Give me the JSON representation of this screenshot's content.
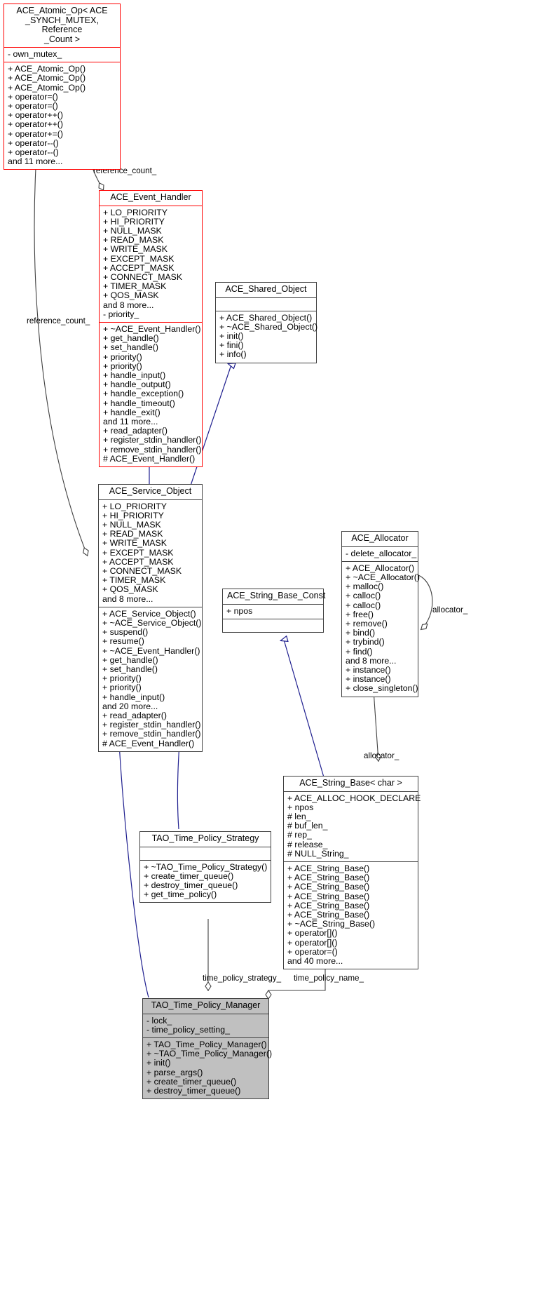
{
  "diagram": {
    "kind": "uml-class-collaboration-diagram",
    "colors": {
      "highlight_border": "#ff0000",
      "plain_border": "#404040",
      "focus_fill": "#c0c0c0",
      "inheritance_edge": "#1f1f8f",
      "aggregation_edge": "#404040",
      "background": "#ffffff"
    }
  },
  "nodes": {
    "ace_atomic_op": {
      "title": "ACE_Atomic_Op< ACE\n_SYNCH_MUTEX, Reference\n_Count >",
      "attributes": [
        "- own_mutex_"
      ],
      "operations": [
        "+ ACE_Atomic_Op()",
        "+ ACE_Atomic_Op()",
        "+ ACE_Atomic_Op()",
        "+ operator=()",
        "+ operator=()",
        "+ operator++()",
        "+ operator++()",
        "+ operator+=()",
        "+ operator--()",
        "+ operator--()",
        "and 11 more..."
      ]
    },
    "ace_event_handler": {
      "title": "ACE_Event_Handler",
      "attributes": [
        "+ LO_PRIORITY",
        "+ HI_PRIORITY",
        "+ NULL_MASK",
        "+ READ_MASK",
        "+ WRITE_MASK",
        "+ EXCEPT_MASK",
        "+ ACCEPT_MASK",
        "+ CONNECT_MASK",
        "+ TIMER_MASK",
        "+ QOS_MASK",
        "and 8 more...",
        "- priority_"
      ],
      "operations": [
        "+ ~ACE_Event_Handler()",
        "+ get_handle()",
        "+ set_handle()",
        "+ priority()",
        "+ priority()",
        "+ handle_input()",
        "+ handle_output()",
        "+ handle_exception()",
        "+ handle_timeout()",
        "+ handle_exit()",
        "and 11 more...",
        "+ read_adapter()",
        "+ register_stdin_handler()",
        "+ remove_stdin_handler()",
        "# ACE_Event_Handler()"
      ]
    },
    "ace_shared_object": {
      "title": "ACE_Shared_Object",
      "attributes": [],
      "operations": [
        "+ ACE_Shared_Object()",
        "+ ~ACE_Shared_Object()",
        "+ init()",
        "+ fini()",
        "+ info()"
      ]
    },
    "ace_service_object": {
      "title": "ACE_Service_Object",
      "attributes": [
        "+ LO_PRIORITY",
        "+ HI_PRIORITY",
        "+ NULL_MASK",
        "+ READ_MASK",
        "+ WRITE_MASK",
        "+ EXCEPT_MASK",
        "+ ACCEPT_MASK",
        "+ CONNECT_MASK",
        "+ TIMER_MASK",
        "+ QOS_MASK",
        "and 8 more..."
      ],
      "operations": [
        "+ ACE_Service_Object()",
        "+ ~ACE_Service_Object()",
        "+ suspend()",
        "+ resume()",
        "+ ~ACE_Event_Handler()",
        "+ get_handle()",
        "+ set_handle()",
        "+ priority()",
        "+ priority()",
        "+ handle_input()",
        "and 20 more...",
        "+ read_adapter()",
        "+ register_stdin_handler()",
        "+ remove_stdin_handler()",
        "# ACE_Event_Handler()"
      ]
    },
    "ace_allocator": {
      "title": "ACE_Allocator",
      "attributes": [
        "- delete_allocator_"
      ],
      "operations": [
        "+ ACE_Allocator()",
        "+ ~ACE_Allocator()",
        "+ malloc()",
        "+ calloc()",
        "+ calloc()",
        "+ free()",
        "+ remove()",
        "+ bind()",
        "+ trybind()",
        "+ find()",
        "and 8 more...",
        "+ instance()",
        "+ instance()",
        "+ close_singleton()"
      ]
    },
    "ace_string_base_const": {
      "title": "ACE_String_Base_Const",
      "attributes": [
        "+ npos"
      ],
      "operations": []
    },
    "ace_string_base_char": {
      "title": "ACE_String_Base< char >",
      "attributes": [
        "+ ACE_ALLOC_HOOK_DECLARE",
        "+ npos",
        "# len_",
        "# buf_len_",
        "# rep_",
        "# release_",
        "# NULL_String_"
      ],
      "operations": [
        "+ ACE_String_Base()",
        "+ ACE_String_Base()",
        "+ ACE_String_Base()",
        "+ ACE_String_Base()",
        "+ ACE_String_Base()",
        "+ ACE_String_Base()",
        "+ ~ACE_String_Base()",
        "+ operator[]()",
        "+ operator[]()",
        "+ operator=()",
        "and 40 more..."
      ]
    },
    "tao_time_policy_strategy": {
      "title": "TAO_Time_Policy_Strategy",
      "attributes": [],
      "operations": [
        "+ ~TAO_Time_Policy_Strategy()",
        "+ create_timer_queue()",
        "+ destroy_timer_queue()",
        "+ get_time_policy()"
      ]
    },
    "tao_time_policy_manager": {
      "title": "TAO_Time_Policy_Manager",
      "attributes": [
        "- lock_",
        "- time_policy_setting_"
      ],
      "operations": [
        "+ TAO_Time_Policy_Manager()",
        "+ ~TAO_Time_Policy_Manager()",
        "+ init()",
        "+ parse_args()",
        "+ create_timer_queue()",
        "+ destroy_timer_queue()"
      ]
    }
  },
  "edge_labels": {
    "reference_count_top": "reference_count_",
    "reference_count_left": "reference_count_",
    "allocator_right": "allocator_",
    "allocator_lower": "allocator_",
    "time_policy_strategy": "time_policy_strategy_",
    "time_policy_name": "time_policy_name_"
  }
}
